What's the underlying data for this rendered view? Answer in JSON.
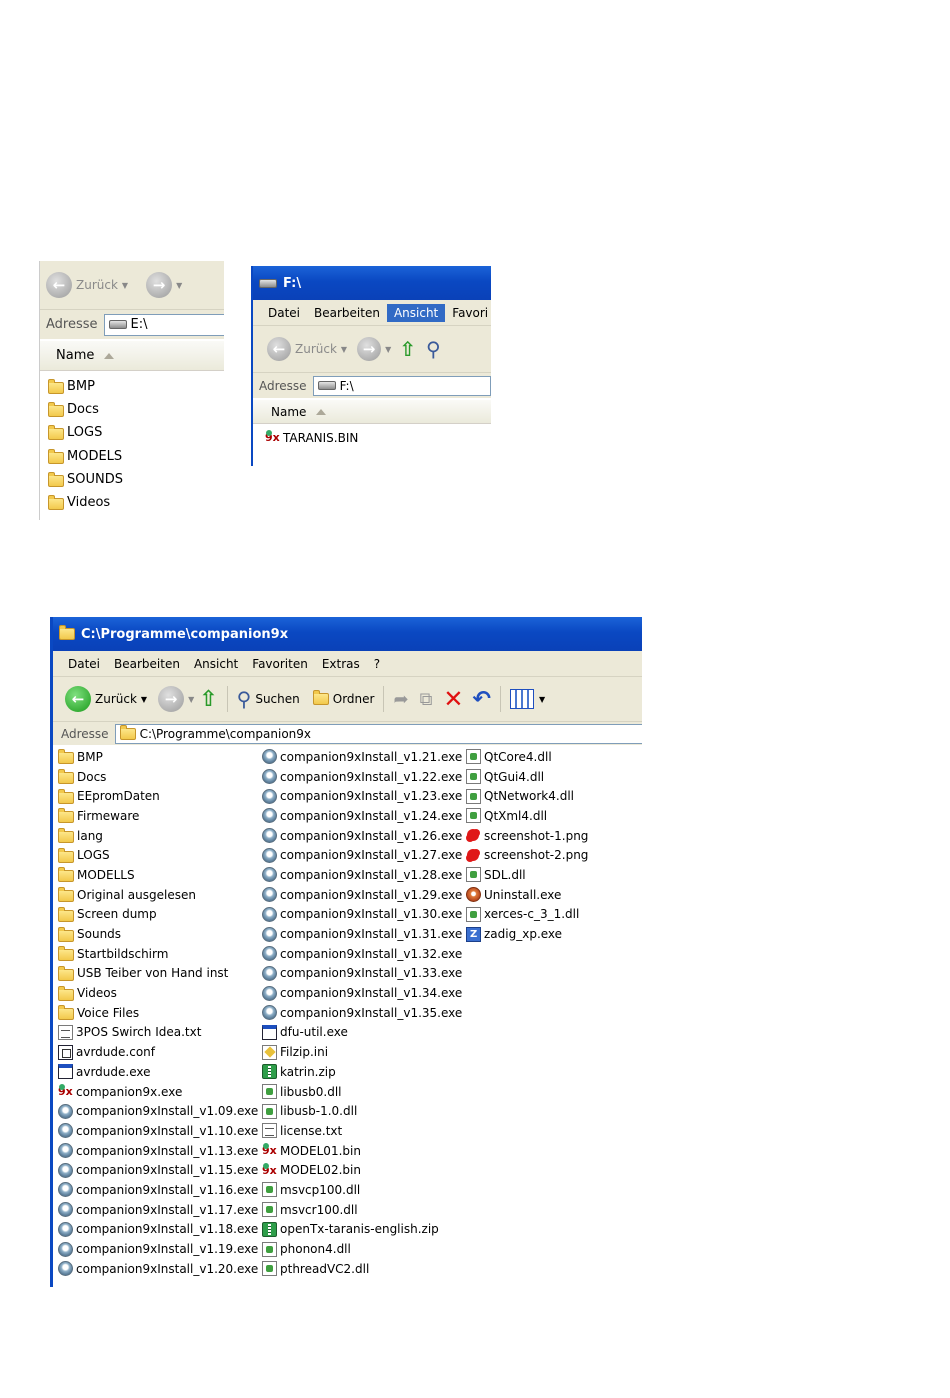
{
  "window1": {
    "back_label": "Zurück",
    "address_label": "Adresse",
    "address_value": "E:\\",
    "column_name": "Name",
    "items": [
      "BMP",
      "Docs",
      "LOGS",
      "MODELS",
      "SOUNDS",
      "Videos"
    ]
  },
  "window2": {
    "title": "F:\\",
    "menu": [
      "Datei",
      "Bearbeiten",
      "Ansicht",
      "Favori"
    ],
    "active_menu": "Ansicht",
    "back_label": "Zurück",
    "address_label": "Adresse",
    "address_value": "F:\\",
    "column_name": "Name",
    "items": [
      {
        "name": "TARANIS.BIN",
        "icon": "companion-bin-icon"
      }
    ]
  },
  "window3": {
    "title": "C:\\Programme\\companion9x",
    "menu": [
      "Datei",
      "Bearbeiten",
      "Ansicht",
      "Favoriten",
      "Extras",
      "?"
    ],
    "back_label": "Zurück",
    "search_label": "Suchen",
    "folders_label": "Ordner",
    "address_label": "Adresse",
    "address_value": "C:\\Programme\\companion9x",
    "col1": [
      {
        "name": "BMP",
        "icon": "folder"
      },
      {
        "name": "Docs",
        "icon": "folder"
      },
      {
        "name": "EEpromDaten",
        "icon": "folder"
      },
      {
        "name": "Firmeware",
        "icon": "folder"
      },
      {
        "name": "lang",
        "icon": "folder"
      },
      {
        "name": "LOGS",
        "icon": "folder"
      },
      {
        "name": "MODELLS",
        "icon": "folder"
      },
      {
        "name": "Original ausgelesen",
        "icon": "folder"
      },
      {
        "name": "Screen dump",
        "icon": "folder"
      },
      {
        "name": "Sounds",
        "icon": "folder"
      },
      {
        "name": "Startbildschirm",
        "icon": "folder"
      },
      {
        "name": "USB Teiber von Hand inst",
        "icon": "folder"
      },
      {
        "name": "Videos",
        "icon": "folder"
      },
      {
        "name": "Voice Files",
        "icon": "folder"
      },
      {
        "name": "3POS Swirch Idea.txt",
        "icon": "txt"
      },
      {
        "name": "avrdude.conf",
        "icon": "conf"
      },
      {
        "name": "avrdude.exe",
        "icon": "win"
      },
      {
        "name": "companion9x.exe",
        "icon": "9x"
      },
      {
        "name": "companion9xInstall_v1.09.exe",
        "icon": "exe"
      },
      {
        "name": "companion9xInstall_v1.10.exe",
        "icon": "exe"
      },
      {
        "name": "companion9xInstall_v1.13.exe",
        "icon": "exe"
      },
      {
        "name": "companion9xInstall_v1.15.exe",
        "icon": "exe"
      },
      {
        "name": "companion9xInstall_v1.16.exe",
        "icon": "exe"
      },
      {
        "name": "companion9xInstall_v1.17.exe",
        "icon": "exe"
      },
      {
        "name": "companion9xInstall_v1.18.exe",
        "icon": "exe"
      },
      {
        "name": "companion9xInstall_v1.19.exe",
        "icon": "exe"
      },
      {
        "name": "companion9xInstall_v1.20.exe",
        "icon": "exe"
      }
    ],
    "col2": [
      {
        "name": "companion9xInstall_v1.21.exe",
        "icon": "exe"
      },
      {
        "name": "companion9xInstall_v1.22.exe",
        "icon": "exe"
      },
      {
        "name": "companion9xInstall_v1.23.exe",
        "icon": "exe"
      },
      {
        "name": "companion9xInstall_v1.24.exe",
        "icon": "exe"
      },
      {
        "name": "companion9xInstall_v1.26.exe",
        "icon": "exe"
      },
      {
        "name": "companion9xInstall_v1.27.exe",
        "icon": "exe"
      },
      {
        "name": "companion9xInstall_v1.28.exe",
        "icon": "exe"
      },
      {
        "name": "companion9xInstall_v1.29.exe",
        "icon": "exe"
      },
      {
        "name": "companion9xInstall_v1.30.exe",
        "icon": "exe"
      },
      {
        "name": "companion9xInstall_v1.31.exe",
        "icon": "exe"
      },
      {
        "name": "companion9xInstall_v1.32.exe",
        "icon": "exe"
      },
      {
        "name": "companion9xInstall_v1.33.exe",
        "icon": "exe"
      },
      {
        "name": "companion9xInstall_v1.34.exe",
        "icon": "exe"
      },
      {
        "name": "companion9xInstall_v1.35.exe",
        "icon": "exe"
      },
      {
        "name": "dfu-util.exe",
        "icon": "win"
      },
      {
        "name": "Filzip.ini",
        "icon": "ini"
      },
      {
        "name": "katrin.zip",
        "icon": "zip"
      },
      {
        "name": "libusb0.dll",
        "icon": "dll"
      },
      {
        "name": "libusb-1.0.dll",
        "icon": "dll"
      },
      {
        "name": "license.txt",
        "icon": "txt"
      },
      {
        "name": "MODEL01.bin",
        "icon": "9x"
      },
      {
        "name": "MODEL02.bin",
        "icon": "9x"
      },
      {
        "name": "msvcp100.dll",
        "icon": "dll"
      },
      {
        "name": "msvcr100.dll",
        "icon": "dll"
      },
      {
        "name": "openTx-taranis-english.zip",
        "icon": "zip"
      },
      {
        "name": "phonon4.dll",
        "icon": "dll"
      },
      {
        "name": "pthreadVC2.dll",
        "icon": "dll"
      }
    ],
    "col3": [
      {
        "name": "QtCore4.dll",
        "icon": "dll"
      },
      {
        "name": "QtGui4.dll",
        "icon": "dll"
      },
      {
        "name": "QtNetwork4.dll",
        "icon": "dll"
      },
      {
        "name": "QtXml4.dll",
        "icon": "dll"
      },
      {
        "name": "screenshot-1.png",
        "icon": "png"
      },
      {
        "name": "screenshot-2.png",
        "icon": "png"
      },
      {
        "name": "SDL.dll",
        "icon": "dll"
      },
      {
        "name": "Uninstall.exe",
        "icon": "uninst"
      },
      {
        "name": "xerces-c_3_1.dll",
        "icon": "dll"
      },
      {
        "name": "zadig_xp.exe",
        "icon": "zadig"
      }
    ]
  }
}
